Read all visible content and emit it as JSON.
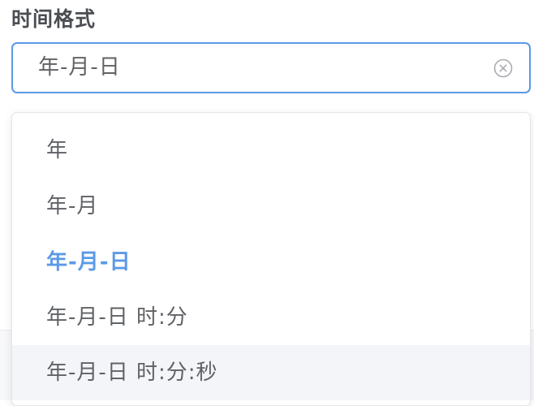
{
  "field": {
    "label": "时间格式",
    "value": "年-月-日",
    "clear_icon": "circle-x-icon"
  },
  "dropdown": {
    "options": [
      {
        "label": "年",
        "selected": false,
        "hovered": false
      },
      {
        "label": "年-月",
        "selected": false,
        "hovered": false
      },
      {
        "label": "年-月-日",
        "selected": true,
        "hovered": false
      },
      {
        "label": "年-月-日 时:分",
        "selected": false,
        "hovered": false
      },
      {
        "label": "年-月-日 时:分:秒",
        "selected": false,
        "hovered": true
      }
    ]
  },
  "colors": {
    "accent": "#5b9ae6",
    "text": "#5f6266",
    "label": "#4a4d52",
    "hover_bg": "#f4f5f8"
  }
}
